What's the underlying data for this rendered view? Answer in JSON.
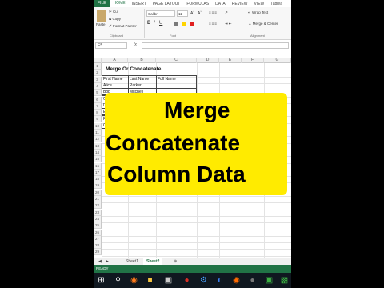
{
  "ribbon": {
    "tabs": [
      "FILE",
      "HOME",
      "INSERT",
      "PAGE LAYOUT",
      "FORMULAS",
      "DATA",
      "REVIEW",
      "VIEW",
      "Tablea"
    ],
    "clipboard": {
      "paste": "Paste",
      "cut": "Cut",
      "copy": "Copy",
      "format_painter": "Format Painter",
      "group_label": "Clipboard"
    },
    "font": {
      "name": "Calibri",
      "size": "11",
      "group_label": "Font"
    },
    "alignment": {
      "wrap_text": "Wrap Text",
      "merge": "Merge & Center",
      "group_label": "Alignment"
    }
  },
  "formula_bar": {
    "name_box": "E5",
    "fx": "fx",
    "value": ""
  },
  "grid": {
    "columns": [
      "A",
      "B",
      "C",
      "D",
      "E",
      "F",
      "G"
    ],
    "rows": [
      "1",
      "2",
      "3",
      "4",
      "5",
      "6",
      "7",
      "8",
      "9",
      "10",
      "11",
      "12",
      "13",
      "14",
      "15",
      "16",
      "17",
      "18",
      "19",
      "20",
      "21",
      "22",
      "23",
      "24",
      "25",
      "26",
      "27",
      "28",
      "29"
    ],
    "title": "Merge Or Concatenate",
    "headers": [
      "First Name",
      "Last Name",
      "Full Name"
    ],
    "first_names": [
      "Alice",
      "Bob",
      "Carol",
      "Daniel",
      "Eve",
      "Frank",
      "George"
    ],
    "last_names": [
      "Parker",
      "Mitchell",
      "",
      "",
      "",
      "",
      ""
    ]
  },
  "sheets": [
    "Sheet1",
    "Sheet2"
  ],
  "status": "READY",
  "overlay": {
    "line1": "Merge",
    "line2": "Concatenate",
    "line3": "Column Data"
  },
  "colors": {
    "excel_green": "#217346",
    "highlight_yellow": "#ffeb00"
  }
}
